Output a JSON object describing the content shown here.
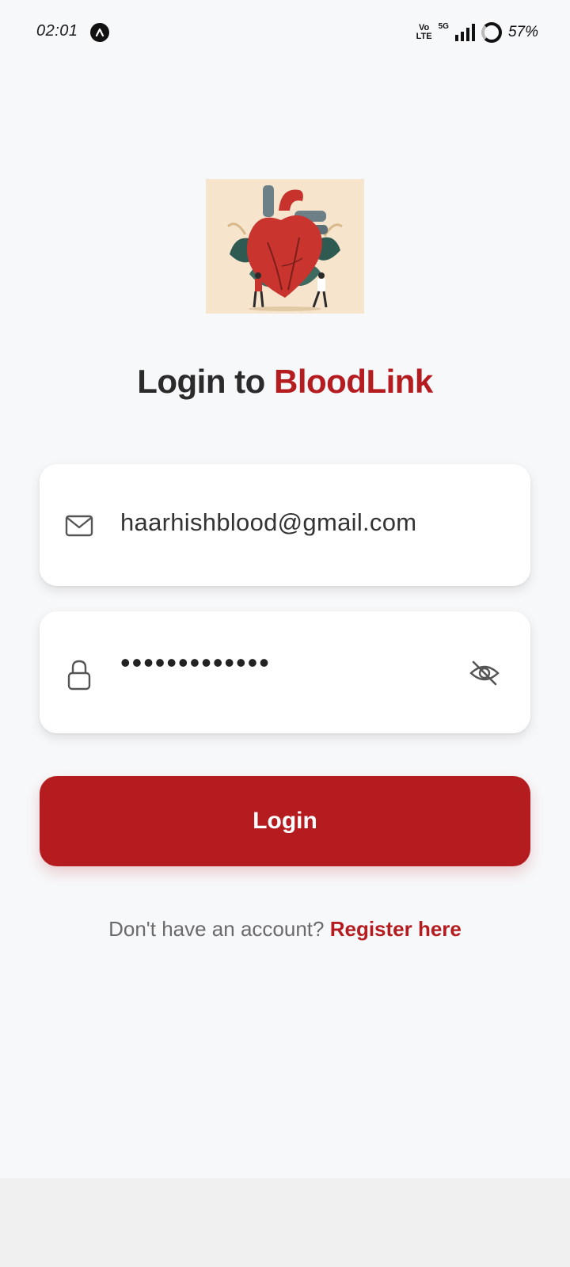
{
  "status_bar": {
    "time": "02:01",
    "network_type": "5G",
    "volte_top": "Vo",
    "volte_bottom": "LTE",
    "battery": "57%"
  },
  "title": {
    "prefix": "Login to ",
    "brand": "BloodLink"
  },
  "form": {
    "email_value": "haarhishblood@gmail.com",
    "password_value": "•••••••••••••",
    "login_label": "Login"
  },
  "register": {
    "prompt": "Don't have an account? ",
    "link": "Register here"
  },
  "colors": {
    "accent": "#b51c20",
    "background": "#f7f8fa"
  },
  "icons": [
    "mail-icon",
    "lock-icon",
    "eye-off-icon",
    "heart-illustration"
  ]
}
